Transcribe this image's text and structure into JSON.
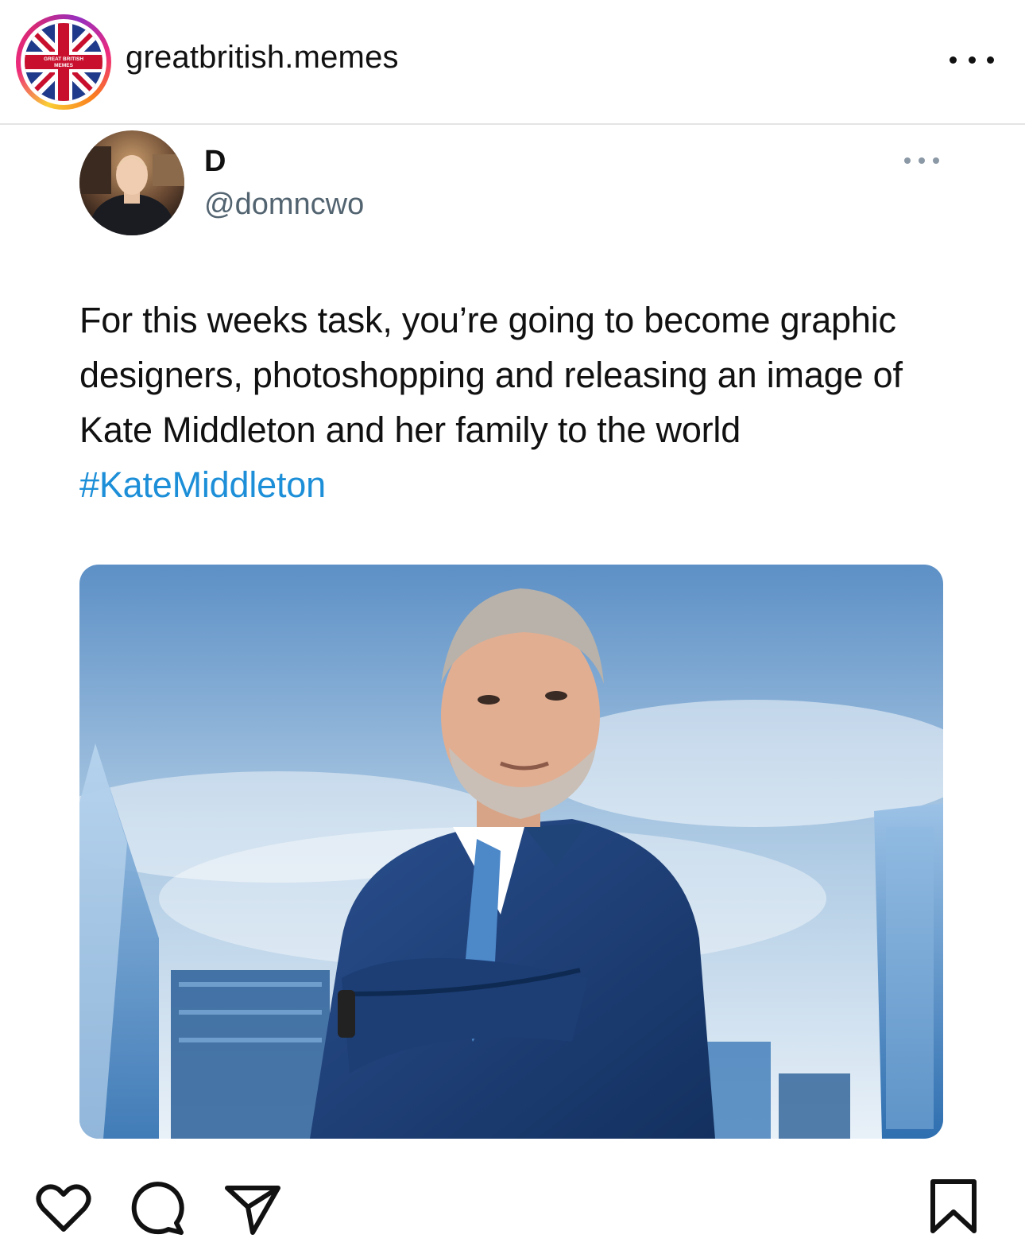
{
  "post": {
    "account": {
      "username": "greatbritish.memes",
      "avatar_text": "GREAT BRITISH MEMES",
      "avatar_icon": "union-jack-logo"
    },
    "more_icon": "ellipsis-icon"
  },
  "tweet": {
    "display_name": "D",
    "handle": "@domncwo",
    "text": "For this weeks task, you’re going to become graphic designers, photoshopping and releasing an image of Kate Middleton and her family to the world ",
    "hashtag": "#KateMiddleton",
    "media_icon": "photo-businessman-skyline"
  },
  "actions": {
    "like_icon": "heart-icon",
    "comment_icon": "comment-icon",
    "share_icon": "send-icon",
    "save_icon": "bookmark-icon"
  },
  "colors": {
    "hashtag": "#1d8fd8",
    "handle": "#536471",
    "text": "#111111",
    "ring_start": "#f9ce34",
    "ring_mid": "#ee2a7b",
    "ring_end": "#962fbf"
  }
}
